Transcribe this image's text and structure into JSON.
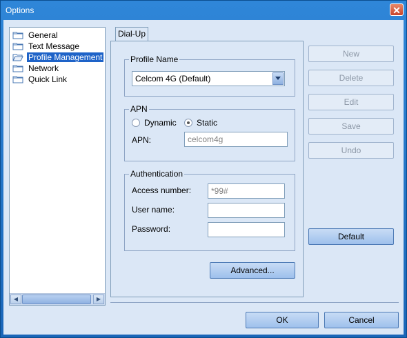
{
  "window": {
    "title": "Options"
  },
  "tree": {
    "items": [
      {
        "label": "General",
        "selected": false
      },
      {
        "label": "Text Message",
        "selected": false
      },
      {
        "label": "Profile Management",
        "selected": true
      },
      {
        "label": "Network",
        "selected": false
      },
      {
        "label": "Quick Link",
        "selected": false
      }
    ]
  },
  "tab": {
    "label": "Dial-Up"
  },
  "profile": {
    "group_label": "Profile Name",
    "selected": "Celcom 4G (Default)"
  },
  "apn": {
    "group_label": "APN",
    "dynamic_label": "Dynamic",
    "static_label": "Static",
    "selected_mode": "Static",
    "apn_label": "APN:",
    "apn_value": "celcom4g"
  },
  "auth": {
    "group_label": "Authentication",
    "access_label": "Access number:",
    "access_value": "*99#",
    "user_label": "User name:",
    "user_value": "",
    "password_label": "Password:",
    "password_value": ""
  },
  "buttons": {
    "new": "New",
    "delete": "Delete",
    "edit": "Edit",
    "save": "Save",
    "undo": "Undo",
    "default": "Default",
    "advanced": "Advanced...",
    "ok": "OK",
    "cancel": "Cancel"
  },
  "colors": {
    "title_bar": "#2f86d8",
    "selection": "#1e63c8",
    "client_bg": "#dbe7f6"
  }
}
